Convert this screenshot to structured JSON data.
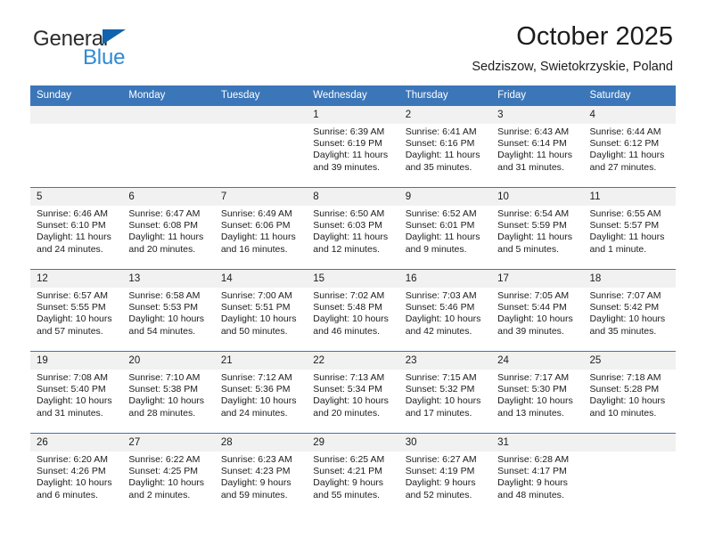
{
  "logo": {
    "word_one": "General",
    "word_two": "Blue",
    "triangle_icon": "triangle-icon",
    "brand_blue": "#2f8ad4",
    "triangle_blue": "#1263ad"
  },
  "header": {
    "title": "October 2025",
    "subtitle": "Sedziszow, Swietokrzyskie, Poland"
  },
  "theme": {
    "header_blue": "#3b76b9",
    "date_strip_gray": "#f1f1f1",
    "text": "#1c1c1c"
  },
  "calendar": {
    "day_names": [
      "Sunday",
      "Monday",
      "Tuesday",
      "Wednesday",
      "Thursday",
      "Friday",
      "Saturday"
    ],
    "weeks": [
      [
        {
          "day": "",
          "lines": []
        },
        {
          "day": "",
          "lines": []
        },
        {
          "day": "",
          "lines": []
        },
        {
          "day": "1",
          "lines": [
            "Sunrise: 6:39 AM",
            "Sunset: 6:19 PM",
            "Daylight: 11 hours",
            "and 39 minutes."
          ]
        },
        {
          "day": "2",
          "lines": [
            "Sunrise: 6:41 AM",
            "Sunset: 6:16 PM",
            "Daylight: 11 hours",
            "and 35 minutes."
          ]
        },
        {
          "day": "3",
          "lines": [
            "Sunrise: 6:43 AM",
            "Sunset: 6:14 PM",
            "Daylight: 11 hours",
            "and 31 minutes."
          ]
        },
        {
          "day": "4",
          "lines": [
            "Sunrise: 6:44 AM",
            "Sunset: 6:12 PM",
            "Daylight: 11 hours",
            "and 27 minutes."
          ]
        }
      ],
      [
        {
          "day": "5",
          "lines": [
            "Sunrise: 6:46 AM",
            "Sunset: 6:10 PM",
            "Daylight: 11 hours",
            "and 24 minutes."
          ]
        },
        {
          "day": "6",
          "lines": [
            "Sunrise: 6:47 AM",
            "Sunset: 6:08 PM",
            "Daylight: 11 hours",
            "and 20 minutes."
          ]
        },
        {
          "day": "7",
          "lines": [
            "Sunrise: 6:49 AM",
            "Sunset: 6:06 PM",
            "Daylight: 11 hours",
            "and 16 minutes."
          ]
        },
        {
          "day": "8",
          "lines": [
            "Sunrise: 6:50 AM",
            "Sunset: 6:03 PM",
            "Daylight: 11 hours",
            "and 12 minutes."
          ]
        },
        {
          "day": "9",
          "lines": [
            "Sunrise: 6:52 AM",
            "Sunset: 6:01 PM",
            "Daylight: 11 hours",
            "and 9 minutes."
          ]
        },
        {
          "day": "10",
          "lines": [
            "Sunrise: 6:54 AM",
            "Sunset: 5:59 PM",
            "Daylight: 11 hours",
            "and 5 minutes."
          ]
        },
        {
          "day": "11",
          "lines": [
            "Sunrise: 6:55 AM",
            "Sunset: 5:57 PM",
            "Daylight: 11 hours",
            "and 1 minute."
          ]
        }
      ],
      [
        {
          "day": "12",
          "lines": [
            "Sunrise: 6:57 AM",
            "Sunset: 5:55 PM",
            "Daylight: 10 hours",
            "and 57 minutes."
          ]
        },
        {
          "day": "13",
          "lines": [
            "Sunrise: 6:58 AM",
            "Sunset: 5:53 PM",
            "Daylight: 10 hours",
            "and 54 minutes."
          ]
        },
        {
          "day": "14",
          "lines": [
            "Sunrise: 7:00 AM",
            "Sunset: 5:51 PM",
            "Daylight: 10 hours",
            "and 50 minutes."
          ]
        },
        {
          "day": "15",
          "lines": [
            "Sunrise: 7:02 AM",
            "Sunset: 5:48 PM",
            "Daylight: 10 hours",
            "and 46 minutes."
          ]
        },
        {
          "day": "16",
          "lines": [
            "Sunrise: 7:03 AM",
            "Sunset: 5:46 PM",
            "Daylight: 10 hours",
            "and 42 minutes."
          ]
        },
        {
          "day": "17",
          "lines": [
            "Sunrise: 7:05 AM",
            "Sunset: 5:44 PM",
            "Daylight: 10 hours",
            "and 39 minutes."
          ]
        },
        {
          "day": "18",
          "lines": [
            "Sunrise: 7:07 AM",
            "Sunset: 5:42 PM",
            "Daylight: 10 hours",
            "and 35 minutes."
          ]
        }
      ],
      [
        {
          "day": "19",
          "lines": [
            "Sunrise: 7:08 AM",
            "Sunset: 5:40 PM",
            "Daylight: 10 hours",
            "and 31 minutes."
          ]
        },
        {
          "day": "20",
          "lines": [
            "Sunrise: 7:10 AM",
            "Sunset: 5:38 PM",
            "Daylight: 10 hours",
            "and 28 minutes."
          ]
        },
        {
          "day": "21",
          "lines": [
            "Sunrise: 7:12 AM",
            "Sunset: 5:36 PM",
            "Daylight: 10 hours",
            "and 24 minutes."
          ]
        },
        {
          "day": "22",
          "lines": [
            "Sunrise: 7:13 AM",
            "Sunset: 5:34 PM",
            "Daylight: 10 hours",
            "and 20 minutes."
          ]
        },
        {
          "day": "23",
          "lines": [
            "Sunrise: 7:15 AM",
            "Sunset: 5:32 PM",
            "Daylight: 10 hours",
            "and 17 minutes."
          ]
        },
        {
          "day": "24",
          "lines": [
            "Sunrise: 7:17 AM",
            "Sunset: 5:30 PM",
            "Daylight: 10 hours",
            "and 13 minutes."
          ]
        },
        {
          "day": "25",
          "lines": [
            "Sunrise: 7:18 AM",
            "Sunset: 5:28 PM",
            "Daylight: 10 hours",
            "and 10 minutes."
          ]
        }
      ],
      [
        {
          "day": "26",
          "lines": [
            "Sunrise: 6:20 AM",
            "Sunset: 4:26 PM",
            "Daylight: 10 hours",
            "and 6 minutes."
          ]
        },
        {
          "day": "27",
          "lines": [
            "Sunrise: 6:22 AM",
            "Sunset: 4:25 PM",
            "Daylight: 10 hours",
            "and 2 minutes."
          ]
        },
        {
          "day": "28",
          "lines": [
            "Sunrise: 6:23 AM",
            "Sunset: 4:23 PM",
            "Daylight: 9 hours",
            "and 59 minutes."
          ]
        },
        {
          "day": "29",
          "lines": [
            "Sunrise: 6:25 AM",
            "Sunset: 4:21 PM",
            "Daylight: 9 hours",
            "and 55 minutes."
          ]
        },
        {
          "day": "30",
          "lines": [
            "Sunrise: 6:27 AM",
            "Sunset: 4:19 PM",
            "Daylight: 9 hours",
            "and 52 minutes."
          ]
        },
        {
          "day": "31",
          "lines": [
            "Sunrise: 6:28 AM",
            "Sunset: 4:17 PM",
            "Daylight: 9 hours",
            "and 48 minutes."
          ]
        },
        {
          "day": "",
          "lines": []
        }
      ]
    ]
  }
}
